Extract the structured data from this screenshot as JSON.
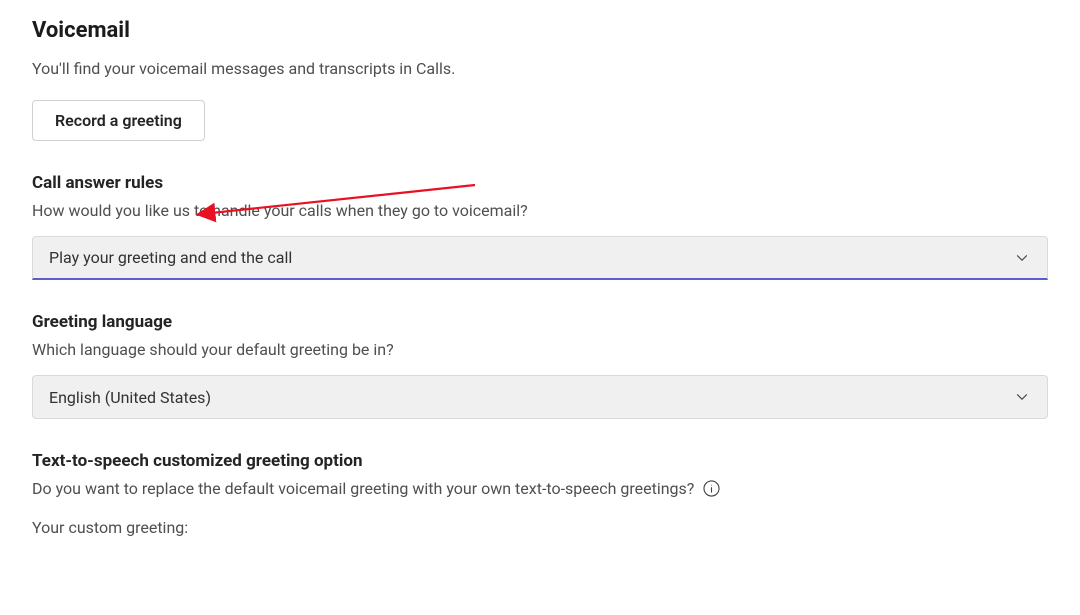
{
  "page": {
    "title": "Voicemail",
    "subtitle": "You'll find your voicemail messages and transcripts in Calls."
  },
  "record_button": {
    "label": "Record a greeting"
  },
  "call_answer_rules": {
    "title": "Call answer rules",
    "description": "How would you like us to handle your calls when they go to voicemail?",
    "selected": "Play your greeting and end the call"
  },
  "greeting_language": {
    "title": "Greeting language",
    "description": "Which language should your default greeting be in?",
    "selected": "English (United States)"
  },
  "text_to_speech": {
    "title": "Text-to-speech customized greeting option",
    "description": "Do you want to replace the default voicemail greeting with your own text-to-speech greetings?",
    "custom_greeting_label": "Your custom greeting:"
  },
  "icons": {
    "chevron_down": "chevron-down-icon",
    "info": "info-icon"
  },
  "colors": {
    "accent": "#5b5fc7",
    "annotation": "#e81123"
  }
}
